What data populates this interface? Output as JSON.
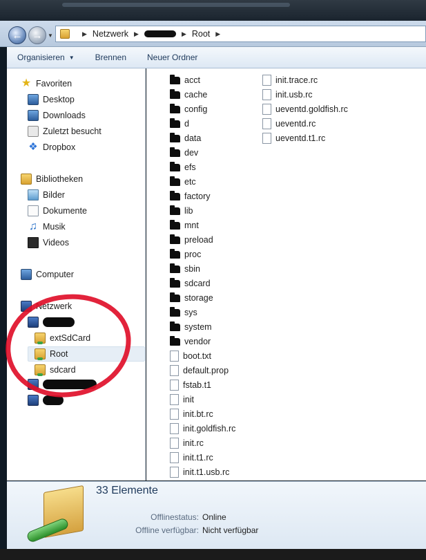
{
  "nav": {
    "breadcrumb": [
      "Netzwerk",
      "Root"
    ]
  },
  "toolbar": {
    "organize": "Organisieren",
    "burn": "Brennen",
    "new_folder": "Neuer Ordner"
  },
  "sidebar": {
    "favorites": {
      "title": "Favoriten",
      "items": [
        "Desktop",
        "Downloads",
        "Zuletzt besucht",
        "Dropbox"
      ]
    },
    "libraries": {
      "title": "Bibliotheken",
      "items": [
        "Bilder",
        "Dokumente",
        "Musik",
        "Videos"
      ]
    },
    "computer": "Computer",
    "network": {
      "title": "Netzwerk",
      "shares": [
        "extSdCard",
        "Root",
        "sdcard"
      ]
    }
  },
  "files": {
    "column1": [
      "acct",
      "cache",
      "config",
      "d",
      "data",
      "dev",
      "efs",
      "etc",
      "factory",
      "lib",
      "mnt",
      "preload",
      "proc",
      "sbin",
      "sdcard",
      "storage",
      "sys",
      "system",
      "vendor",
      "boot.txt",
      "default.prop",
      "fstab.t1",
      "init",
      "init.bt.rc",
      "init.goldfish.rc",
      "init.rc",
      "init.t1.rc",
      "init.t1.usb.rc"
    ],
    "column2": [
      "init.trace.rc",
      "init.usb.rc",
      "ueventd.goldfish.rc",
      "ueventd.rc",
      "ueventd.t1.rc"
    ]
  },
  "details": {
    "count": "33 Elemente",
    "offline_status_label": "Offlinestatus:",
    "offline_status_value": "Online",
    "offline_avail_label": "Offline verfügbar:",
    "offline_avail_value": "Nicht verfügbar"
  }
}
